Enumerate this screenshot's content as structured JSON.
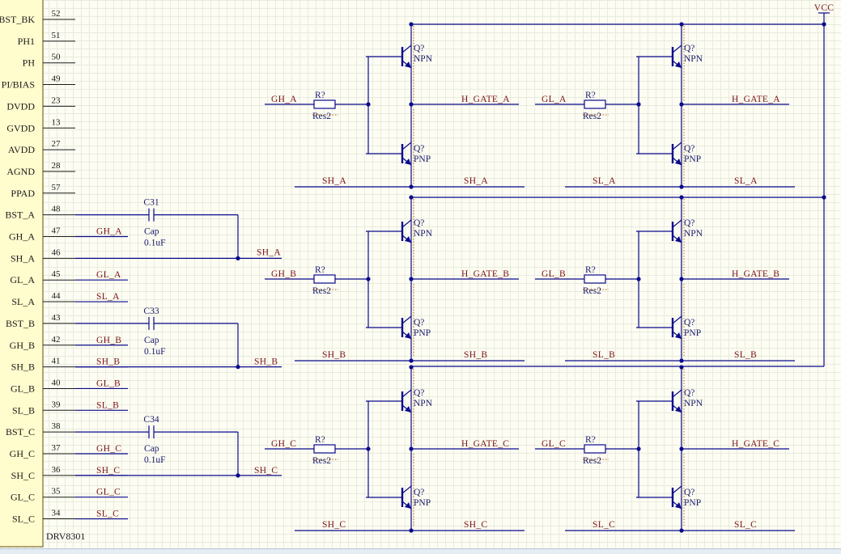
{
  "chip": {
    "name": "DRV8301",
    "pins": [
      {
        "num": "52",
        "label": "BST_BK",
        "net": ""
      },
      {
        "num": "51",
        "label": "PH1",
        "net": ""
      },
      {
        "num": "50",
        "label": "PH",
        "net": ""
      },
      {
        "num": "49",
        "label": "PI/BIAS",
        "net": ""
      },
      {
        "num": "23",
        "label": "DVDD",
        "net": ""
      },
      {
        "num": "13",
        "label": "GVDD",
        "net": ""
      },
      {
        "num": "27",
        "label": "AVDD",
        "net": ""
      },
      {
        "num": "28",
        "label": "AGND",
        "net": ""
      },
      {
        "num": "57",
        "label": "PPAD",
        "net": ""
      },
      {
        "num": "48",
        "label": "BST_A",
        "net": ""
      },
      {
        "num": "47",
        "label": "GH_A",
        "net": "GH_A"
      },
      {
        "num": "46",
        "label": "SH_A",
        "net": ""
      },
      {
        "num": "45",
        "label": "GL_A",
        "net": "GL_A"
      },
      {
        "num": "44",
        "label": "SL_A",
        "net": "SL_A"
      },
      {
        "num": "43",
        "label": "BST_B",
        "net": ""
      },
      {
        "num": "42",
        "label": "GH_B",
        "net": "GH_B"
      },
      {
        "num": "41",
        "label": "SH_B",
        "net": "SH_B"
      },
      {
        "num": "40",
        "label": "GL_B",
        "net": "GL_B"
      },
      {
        "num": "39",
        "label": "SL_B",
        "net": "SL_B"
      },
      {
        "num": "38",
        "label": "BST_C",
        "net": ""
      },
      {
        "num": "37",
        "label": "GH_C",
        "net": "GH_C"
      },
      {
        "num": "36",
        "label": "SH_C",
        "net": "SH_C"
      },
      {
        "num": "35",
        "label": "GL_C",
        "net": "GL_C"
      },
      {
        "num": "34",
        "label": "SL_C",
        "net": "SL_C"
      }
    ]
  },
  "capacitors": [
    {
      "designator": "C31",
      "type": "Cap",
      "value": "0.1uF",
      "net": "SH_A"
    },
    {
      "designator": "C33",
      "type": "Cap",
      "value": "0.1uF",
      "net": "SH_B"
    },
    {
      "designator": "C34",
      "type": "Cap",
      "value": "0.1uF",
      "net": "SH_C"
    }
  ],
  "power": {
    "vcc_label": "VCC"
  },
  "resistor": {
    "designator": "R?",
    "comment": "Res2"
  },
  "transistors": {
    "designator": "Q?",
    "npn": "NPN",
    "pnp": "PNP"
  },
  "drivers": [
    {
      "in": "GH_A",
      "out": "H_GATE_A",
      "bottom_left": "SH_A",
      "bottom_right": "SH_A"
    },
    {
      "in": "GL_A",
      "out": "H_GATE_A",
      "bottom_left": "SL_A",
      "bottom_right": "SL_A"
    },
    {
      "in": "GH_B",
      "out": "H_GATE_B",
      "bottom_left": "SH_B",
      "bottom_right": "SH_B"
    },
    {
      "in": "GL_B",
      "out": "H_GATE_B",
      "bottom_left": "SL_B",
      "bottom_right": "SL_B"
    },
    {
      "in": "GH_C",
      "out": "H_GATE_C",
      "bottom_left": "SH_C",
      "bottom_right": "SH_C"
    },
    {
      "in": "GL_C",
      "out": "H_GATE_C",
      "bottom_left": "SL_C",
      "bottom_right": "SL_C"
    }
  ]
}
